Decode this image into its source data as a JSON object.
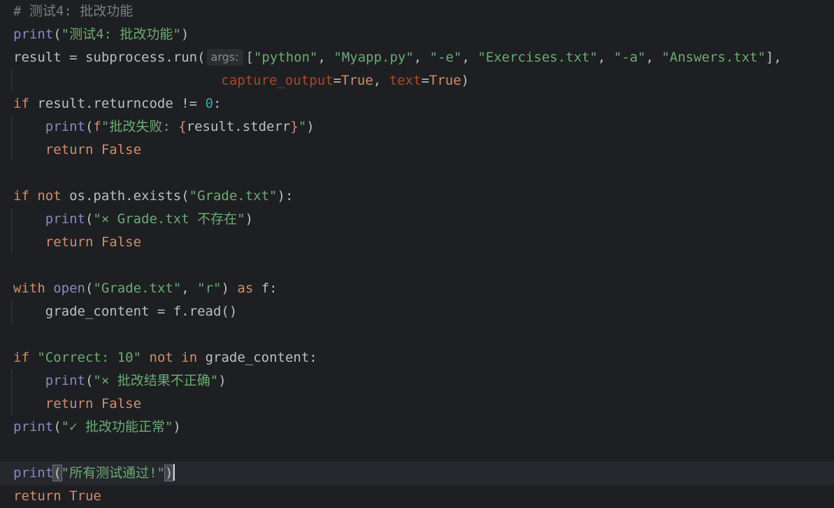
{
  "editor": {
    "theme": {
      "background": "#1e1f22",
      "current_line": "#26282e",
      "keyword": "#cf8e6d",
      "builtin": "#8888c6",
      "string": "#6aab73",
      "number": "#2aacb8",
      "comment": "#7a7e85",
      "param": "#aa4926"
    },
    "lines": [
      {
        "tokens": [
          [
            "cmt",
            "# 测试4: 批改功能"
          ]
        ]
      },
      {
        "tokens": [
          [
            "fn",
            "print"
          ],
          [
            "plain",
            "("
          ],
          [
            "str",
            "\"测试4: 批改功能\""
          ],
          [
            "plain",
            ")"
          ]
        ]
      },
      {
        "tokens": [
          [
            "plain",
            "result = subprocess.run("
          ],
          [
            "hint",
            "args:"
          ],
          [
            "plain",
            "["
          ],
          [
            "str",
            "\"python\""
          ],
          [
            "plain",
            ", "
          ],
          [
            "str",
            "\"Myapp.py\""
          ],
          [
            "plain",
            ", "
          ],
          [
            "str",
            "\"-e\""
          ],
          [
            "plain",
            ", "
          ],
          [
            "str",
            "\"Exercises.txt\""
          ],
          [
            "plain",
            ", "
          ],
          [
            "str",
            "\"-a\""
          ],
          [
            "plain",
            ", "
          ],
          [
            "str",
            "\"Answers.txt\""
          ],
          [
            "plain",
            "],"
          ]
        ]
      },
      {
        "indent": "                          ",
        "tokens": [
          [
            "param",
            "capture_output"
          ],
          [
            "plain",
            "="
          ],
          [
            "kw",
            "True"
          ],
          [
            "plain",
            ", "
          ],
          [
            "param",
            "text"
          ],
          [
            "plain",
            "="
          ],
          [
            "kw",
            "True"
          ],
          [
            "plain",
            ")"
          ]
        ]
      },
      {
        "tokens": [
          [
            "kw",
            "if"
          ],
          [
            "plain",
            " result.returncode != "
          ],
          [
            "num",
            "0"
          ],
          [
            "plain",
            ":"
          ]
        ]
      },
      {
        "indent": "    ",
        "tokens": [
          [
            "fn",
            "print"
          ],
          [
            "plain",
            "("
          ],
          [
            "kw",
            "f"
          ],
          [
            "str",
            "\"批改失败: "
          ],
          [
            "kw",
            "{"
          ],
          [
            "plain",
            "result.stderr"
          ],
          [
            "kw",
            "}"
          ],
          [
            "str",
            "\""
          ],
          [
            "plain",
            ")"
          ]
        ]
      },
      {
        "indent": "    ",
        "tokens": [
          [
            "kw",
            "return False"
          ]
        ]
      },
      {
        "tokens": []
      },
      {
        "tokens": [
          [
            "kw",
            "if not"
          ],
          [
            "plain",
            " os.path.exists("
          ],
          [
            "str",
            "\"Grade.txt\""
          ],
          [
            "plain",
            "):"
          ]
        ]
      },
      {
        "indent": "    ",
        "tokens": [
          [
            "fn",
            "print"
          ],
          [
            "plain",
            "("
          ],
          [
            "str",
            "\"× Grade.txt 不存在\""
          ],
          [
            "plain",
            ")"
          ]
        ]
      },
      {
        "indent": "    ",
        "tokens": [
          [
            "kw",
            "return False"
          ]
        ]
      },
      {
        "tokens": []
      },
      {
        "tokens": [
          [
            "kw",
            "with"
          ],
          [
            "plain",
            " "
          ],
          [
            "fn",
            "open"
          ],
          [
            "plain",
            "("
          ],
          [
            "str",
            "\"Grade.txt\""
          ],
          [
            "plain",
            ", "
          ],
          [
            "str",
            "\"r\""
          ],
          [
            "plain",
            ") "
          ],
          [
            "kw",
            "as"
          ],
          [
            "plain",
            " f:"
          ]
        ]
      },
      {
        "indent": "    ",
        "tokens": [
          [
            "plain",
            "grade_content = f.read()"
          ]
        ]
      },
      {
        "tokens": []
      },
      {
        "tokens": [
          [
            "kw",
            "if"
          ],
          [
            "plain",
            " "
          ],
          [
            "str",
            "\"Correct: 10\""
          ],
          [
            "plain",
            " "
          ],
          [
            "kw",
            "not in"
          ],
          [
            "plain",
            " grade_content:"
          ]
        ]
      },
      {
        "indent": "    ",
        "tokens": [
          [
            "fn",
            "print"
          ],
          [
            "plain",
            "("
          ],
          [
            "str",
            "\"× 批改结果不正确\""
          ],
          [
            "plain",
            ")"
          ]
        ]
      },
      {
        "indent": "    ",
        "tokens": [
          [
            "kw",
            "return False"
          ]
        ]
      },
      {
        "tokens": [
          [
            "fn",
            "print"
          ],
          [
            "plain",
            "("
          ],
          [
            "str",
            "\"✓ 批改功能正常\""
          ],
          [
            "plain",
            ")"
          ]
        ]
      },
      {
        "tokens": []
      },
      {
        "current": true,
        "tokens": [
          [
            "fn",
            "print"
          ],
          [
            "brace",
            "("
          ],
          [
            "str",
            "\"所有测试通过!\""
          ],
          [
            "brace",
            ")"
          ],
          [
            "caret",
            ""
          ]
        ]
      },
      {
        "tokens": [
          [
            "kw",
            "return True"
          ]
        ]
      }
    ]
  }
}
